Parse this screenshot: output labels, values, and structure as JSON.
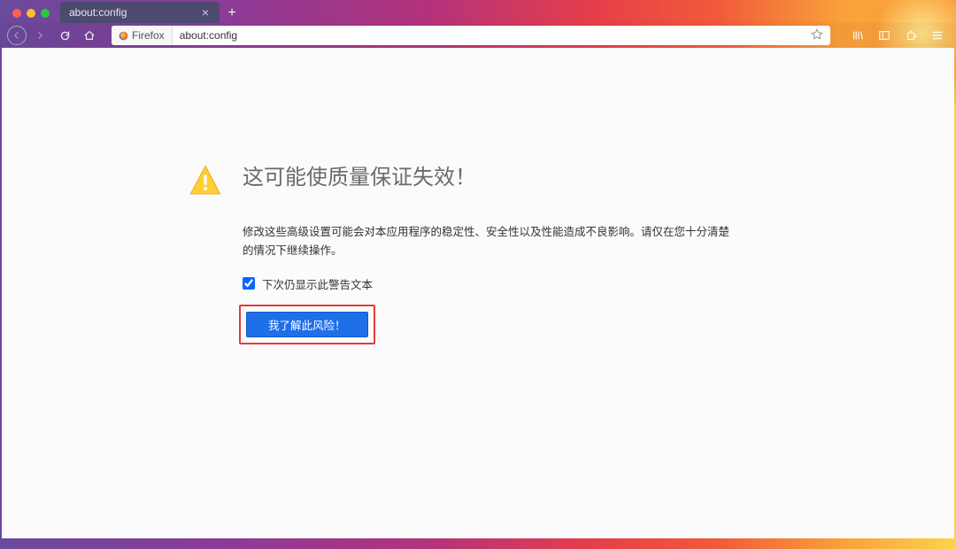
{
  "window": {
    "traffic_lights": [
      "red",
      "yellow",
      "green"
    ]
  },
  "tab": {
    "title": "about:config",
    "close": "×"
  },
  "toolbar": {
    "identity_label": "Firefox",
    "url": "about:config"
  },
  "warning": {
    "title": "这可能使质量保证失效！",
    "body": "修改这些高级设置可能会对本应用程序的稳定性、安全性以及性能造成不良影响。请仅在您十分清楚的情况下继续操作。",
    "checkbox_label": "下次仍显示此警告文本",
    "checkbox_checked": true,
    "accept_label": "我了解此风险！"
  }
}
